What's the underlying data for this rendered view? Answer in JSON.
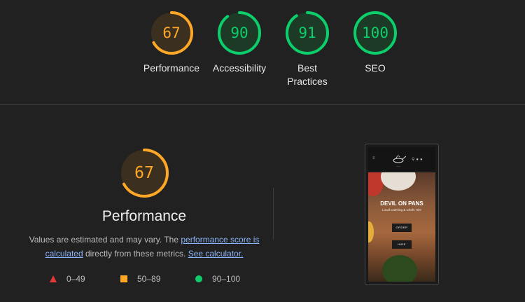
{
  "summary_gauges": [
    {
      "score": "67",
      "label": "Performance",
      "color": "#ffa726",
      "fraction": 0.67
    },
    {
      "score": "90",
      "label": "Accessibility",
      "color": "#0cce6b",
      "fraction": 0.9
    },
    {
      "score": "91",
      "label": "Best Practices",
      "color": "#0cce6b",
      "fraction": 0.91
    },
    {
      "score": "100",
      "label": "SEO",
      "color": "#0cce6b",
      "fraction": 1.0
    }
  ],
  "performance": {
    "score": "67",
    "fraction": 0.67,
    "color": "#ffa726",
    "title": "Performance",
    "desc_prefix": "Values are estimated and may vary. The ",
    "desc_link1": "performance score is calculated",
    "desc_middle": " directly from these metrics. ",
    "desc_link2": "See calculator."
  },
  "legend": [
    {
      "icon": "triangle-icon",
      "range": "0–49",
      "color": "#e53935"
    },
    {
      "icon": "square-icon",
      "range": "50–89",
      "color": "#ffa726"
    },
    {
      "icon": "circle-icon",
      "range": "90–100",
      "color": "#0cce6b"
    }
  ],
  "screenshot": {
    "hero_title": "DEVIL ON PANS",
    "hero_subtitle": "Local Catering & Chefs Hire",
    "btn_order": "ORDER",
    "btn_hire": "HIRE"
  }
}
